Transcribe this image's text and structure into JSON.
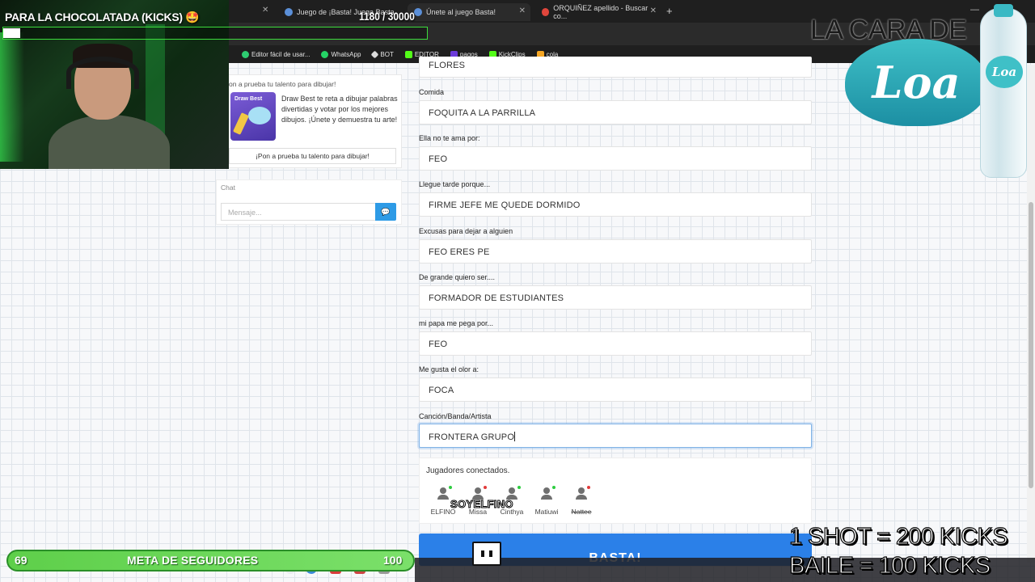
{
  "browser": {
    "tabs": [
      {
        "label": "Juego de ¡Basta! Juega Basta..."
      },
      {
        "label": "Únete al juego Basta!"
      },
      {
        "label": "ORQUIÑEZ apellido - Buscar co..."
      }
    ],
    "new_tab": "+",
    "bookmarks": [
      {
        "label": "Editor fácil de usar...",
        "color": "#2ecc71"
      },
      {
        "label": "WhatsApp",
        "color": "#25d366"
      },
      {
        "label": "BOT",
        "color": "#dddddd"
      },
      {
        "label": "EDITOR",
        "color": "#53fc18"
      },
      {
        "label": "pagos",
        "color": "#6c3bd9"
      },
      {
        "label": "KickClips",
        "color": "#53fc18"
      },
      {
        "label": "cola",
        "color": "#f5a623"
      }
    ]
  },
  "ad": {
    "header": "on a prueba tu talento para dibujar!",
    "image_title": "Draw Best",
    "text": "Draw Best te reta a dibujar palabras divertidas y votar por los mejores dibujos. ¡Únete y demuestra tu arte!",
    "button": "¡Pon a prueba tu talento para dibujar!"
  },
  "chat": {
    "label": "Chat",
    "placeholder": "Mensaje..."
  },
  "form": {
    "partial_top_value": "FLORES",
    "fields": [
      {
        "label": "Comida",
        "value": "FOQUITA A LA PARRILLA"
      },
      {
        "label": "Ella no te ama por:",
        "value": "FEO"
      },
      {
        "label": "Llegue tarde porque...",
        "value": "FIRME JEFE ME QUEDE DORMIDO"
      },
      {
        "label": "Excusas para dejar a alguien",
        "value": "FEO ERES PE"
      },
      {
        "label": "De grande quiero ser....",
        "value": "FORMADOR DE ESTUDIANTES"
      },
      {
        "label": "mi papa me pega por...",
        "value": "FEO"
      },
      {
        "label": "Me gusta el olor a:",
        "value": "FOCA"
      },
      {
        "label": "Canción/Banda/Artista",
        "value": "FRONTERA GRUPO"
      }
    ]
  },
  "players": {
    "title": "Jugadores conectados.",
    "list": [
      {
        "name": "ELFINO",
        "status": "online"
      },
      {
        "name": "Missa",
        "status": "offline"
      },
      {
        "name": "Cinthya",
        "status": "online"
      },
      {
        "name": "Matiuwi",
        "status": "online"
      },
      {
        "name": "Nattee",
        "status": "offline"
      }
    ]
  },
  "basta_button": "BASTA!",
  "overlay": {
    "goal_title": "PARA LA CHOCOLATADA (KICKS) 🤩",
    "goal_count": "1180  / 30000",
    "goal_progress": 0.039,
    "brand_text": "LA CARA DE",
    "brand_logo": "Loa",
    "bottle_label": "Loa",
    "kicks_line1": "1 SHOT = 200 KICKS",
    "kicks_line2": "BAILE = 100 KICKS",
    "followers_current": "69",
    "followers_label": "META DE SEGUIDORES",
    "followers_goal": "100",
    "streamer_tag": "SOYELFINO"
  },
  "colors": {
    "primary": "#2b80e8",
    "goal_green": "#3cdc3c",
    "online": "#2ecc40",
    "offline": "#e23b3b"
  }
}
